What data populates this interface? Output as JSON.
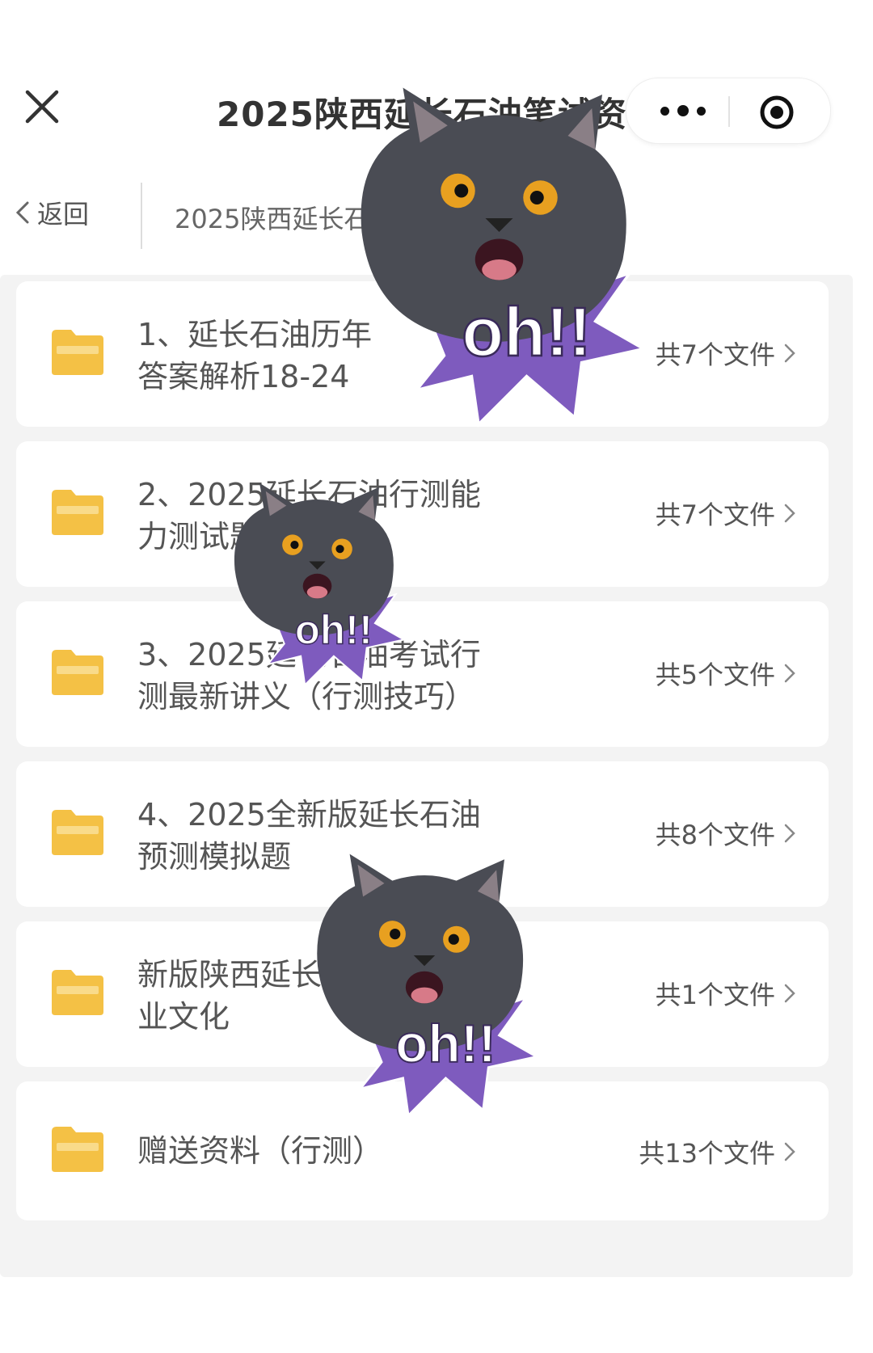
{
  "header": {
    "title": "2025陕西延长石油笔试资料",
    "back_label": "返回",
    "breadcrumb": "2025陕西延长石油笔试资料"
  },
  "folders": [
    {
      "name_line1": "1、延长石油历年",
      "name_line2": "答案解析18-24",
      "count": "共7个文件"
    },
    {
      "name_line1": "2、2025延长石油行测能",
      "name_line2": "力测试题",
      "count": "共7个文件"
    },
    {
      "name_line1": "3、2025延长石油考试行",
      "name_line2": "测最新讲义（行测技巧）",
      "count": "共5个文件"
    },
    {
      "name_line1": "4、2025全新版延长石油",
      "name_line2": "预测模拟题",
      "count": "共8个文件"
    },
    {
      "name_line1": "新版陕西延长石油企",
      "name_line2": "业文化",
      "count": "共1个文件"
    },
    {
      "name_line1": "赠送资料（行测）",
      "name_line2": "",
      "count": "共13个文件"
    }
  ],
  "stickers": [
    {
      "caption": "oh!!"
    },
    {
      "caption": "oh!!"
    },
    {
      "caption": "oh!!"
    }
  ],
  "colors": {
    "folder": "#F4C145",
    "sticker_burst": "#7E5BBE",
    "cat_fur": "#4a4c54",
    "cat_eyes": "#E8A020"
  },
  "icons": {
    "close": "close-icon",
    "more": "more-dots-icon",
    "target": "record-icon",
    "back": "chevron-left-icon",
    "folder": "folder-icon",
    "chevron": "chevron-right-icon"
  }
}
